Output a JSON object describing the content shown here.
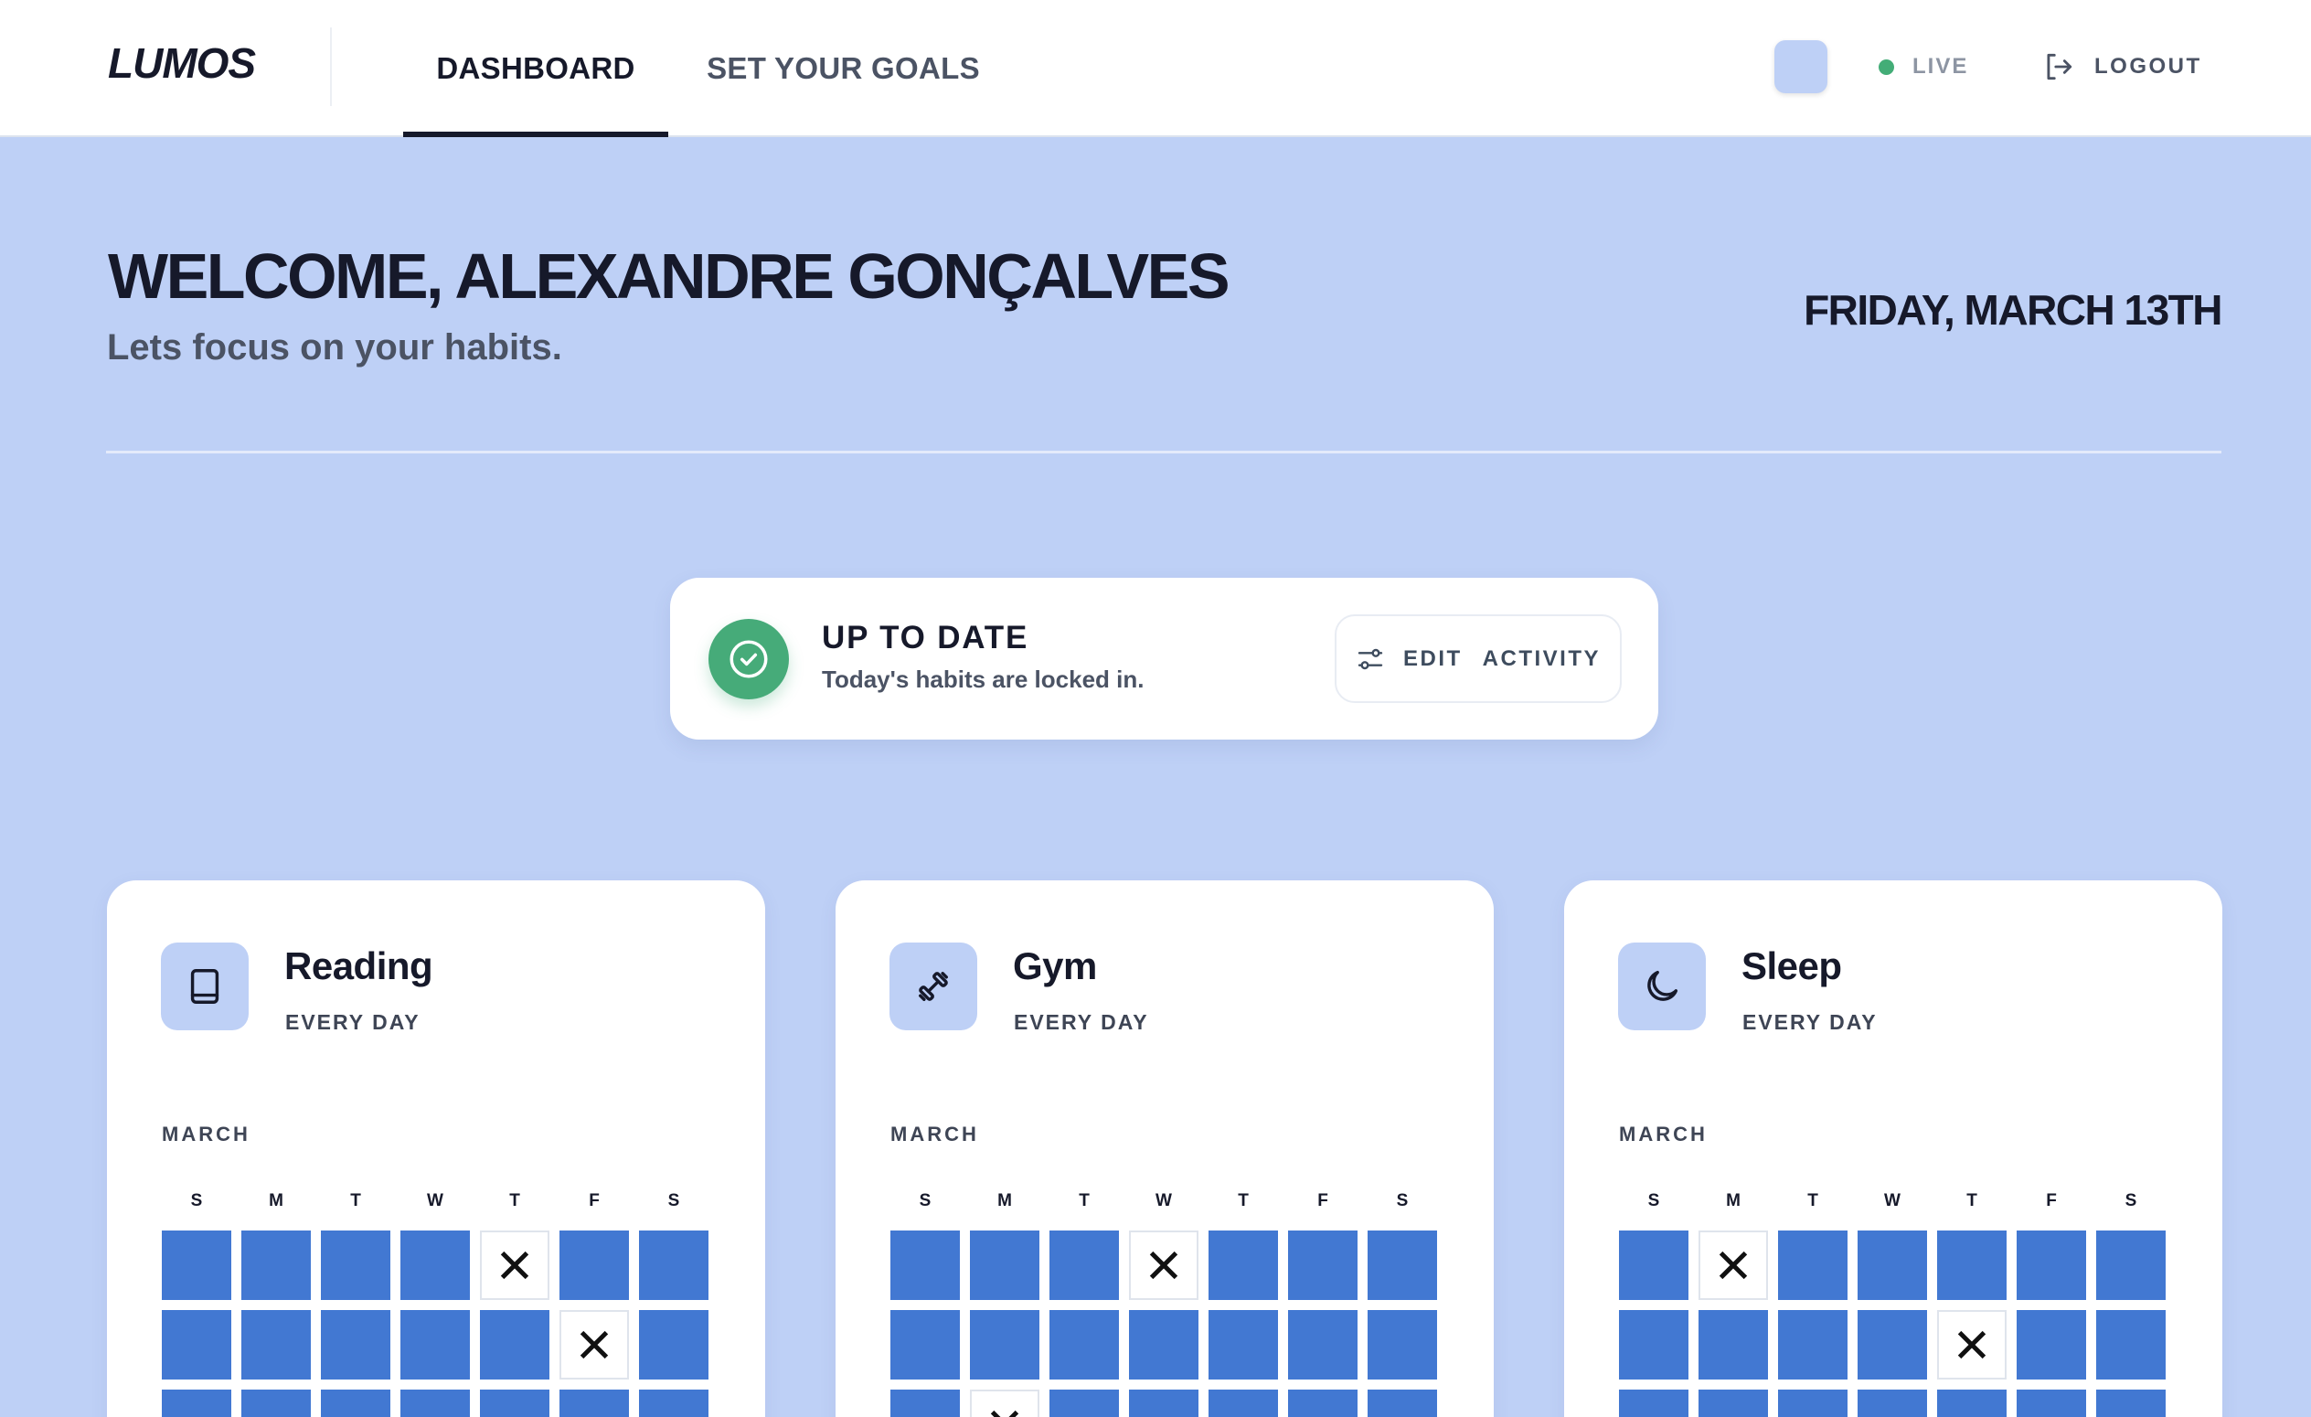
{
  "nav": {
    "logo": "LUMOS",
    "tabs": [
      {
        "label": "DASHBOARD",
        "active": true
      },
      {
        "label": "SET YOUR GOALS",
        "active": false
      }
    ],
    "live_label": "LIVE",
    "logout_label": "LOGOUT"
  },
  "header": {
    "welcome": "WELCOME, ALEXANDRE GONÇALVES",
    "subtitle": "Lets focus on your habits.",
    "date": "FRIDAY, MARCH 13TH"
  },
  "status": {
    "title": "UP TO DATE",
    "subtitle": "Today's habits are locked in.",
    "edit_word1": "EDIT",
    "edit_word2": "ACTIVITY"
  },
  "habits": [
    {
      "name": "Reading",
      "frequency": "EVERY DAY",
      "icon": "book-icon",
      "month": "MARCH",
      "weekdays": [
        "S",
        "M",
        "T",
        "W",
        "T",
        "F",
        "S"
      ],
      "rows": [
        [
          1,
          1,
          1,
          1,
          0,
          1,
          1
        ],
        [
          1,
          1,
          1,
          1,
          1,
          0,
          1
        ],
        [
          1,
          1,
          1,
          1,
          1,
          1,
          1
        ]
      ]
    },
    {
      "name": "Gym",
      "frequency": "EVERY DAY",
      "icon": "dumbbell-icon",
      "month": "MARCH",
      "weekdays": [
        "S",
        "M",
        "T",
        "W",
        "T",
        "F",
        "S"
      ],
      "rows": [
        [
          1,
          1,
          1,
          0,
          1,
          1,
          1
        ],
        [
          1,
          1,
          1,
          1,
          1,
          1,
          1
        ],
        [
          1,
          0,
          1,
          1,
          1,
          1,
          1
        ]
      ]
    },
    {
      "name": "Sleep",
      "frequency": "EVERY DAY",
      "icon": "moon-icon",
      "month": "MARCH",
      "weekdays": [
        "S",
        "M",
        "T",
        "W",
        "T",
        "F",
        "S"
      ],
      "rows": [
        [
          1,
          0,
          1,
          1,
          1,
          1,
          1
        ],
        [
          1,
          1,
          1,
          1,
          0,
          1,
          1
        ],
        [
          1,
          1,
          1,
          1,
          1,
          1,
          1
        ]
      ]
    }
  ],
  "colors": {
    "background": "#bed0f6",
    "done": "#4278d2",
    "accent_green": "#46ab79",
    "text_dark": "#16192a"
  }
}
